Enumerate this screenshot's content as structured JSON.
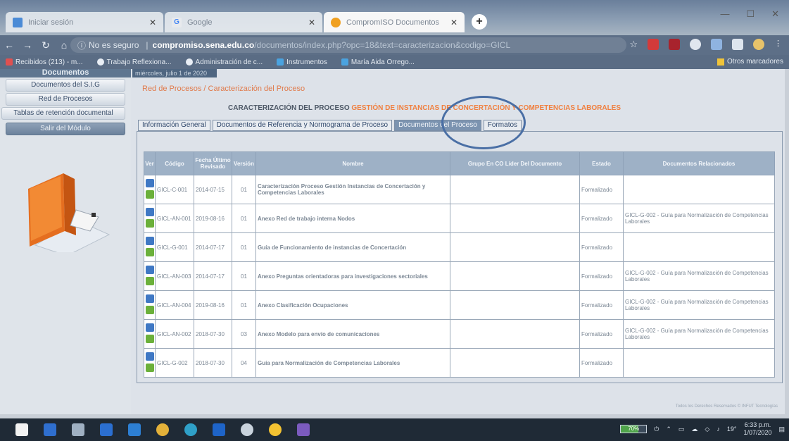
{
  "browser": {
    "tabs": [
      {
        "title": "Iniciar sesión",
        "fav_color": "#4b8bd6"
      },
      {
        "title": "Google",
        "fav_color": "#e8eaed"
      },
      {
        "title": "CompromISO Documentos",
        "fav_color": "#f0a020"
      }
    ],
    "address": {
      "secure_label": "No es seguro",
      "host": "compromiso.sena.edu.co",
      "path": "/documentos/index.php?opc=18&text=caracterizacion&codigo=GICL"
    },
    "bookmarks": [
      "Recibidos (213) - m...",
      "Trabajo Reflexiona...",
      "Administración de c...",
      "Instrumentos",
      "María Aida Orrego..."
    ],
    "bookmarks_other": "Otros marcadores"
  },
  "sidebar": {
    "heading": "Documentos",
    "items": [
      "Documentos del S.I.G",
      "Red de Procesos",
      "Tablas de retención documental",
      "Salir del Módulo"
    ]
  },
  "content": {
    "date_strip": "miércoles, julio 1 de 2020",
    "breadcrumb": "Red de Procesos / Caracterización del Proceso",
    "title_prefix": "CARACTERIZACIÓN DEL PROCESO",
    "title_name": "GESTIÓN DE INSTANCIAS DE CONCERTACIÓN Y COMPETENCIAS LABORALES",
    "tabs": [
      "Información General",
      "Documentos de Referencia y Normograma de Proceso",
      "Documentos del Proceso",
      "Formatos"
    ],
    "selected_tab": 2,
    "table": {
      "headers": [
        "Ver",
        "Código",
        "Fecha Último Revisado",
        "Versión",
        "Nombre",
        "Grupo En CO Líder Del Documento",
        "Estado",
        "Documentos Relacionados"
      ],
      "rows": [
        {
          "codigo": "GICL-C-001",
          "fecha": "2014-07-15",
          "version": "01",
          "nombre": "Caracterización Proceso Gestión Instancias de Concertación y Competencias Laborales",
          "grupo": "",
          "estado": "Formalizado",
          "relacionados": ""
        },
        {
          "codigo": "GICL-AN-001",
          "fecha": "2019-08-16",
          "version": "01",
          "nombre": "Anexo Red de trabajo interna Nodos",
          "grupo": "",
          "estado": "Formalizado",
          "relacionados": "GICL-G-002 - Guía para Normalización de Competencias Laborales"
        },
        {
          "codigo": "GICL-G-001",
          "fecha": "2014-07-17",
          "version": "01",
          "nombre": "Guía de Funcionamiento de instancias de Concertación",
          "grupo": "",
          "estado": "Formalizado",
          "relacionados": ""
        },
        {
          "codigo": "GICL-AN-003",
          "fecha": "2014-07-17",
          "version": "01",
          "nombre": "Anexo Preguntas orientadoras para investigaciones sectoriales",
          "grupo": "",
          "estado": "Formalizado",
          "relacionados": "GICL-G-002 - Guía para Normalización de Competencias Laborales"
        },
        {
          "codigo": "GICL-AN-004",
          "fecha": "2019-08-16",
          "version": "01",
          "nombre": "Anexo Clasificación Ocupaciones",
          "grupo": "",
          "estado": "Formalizado",
          "relacionados": "GICL-G-002 - Guía para Normalización de Competencias Laborales"
        },
        {
          "codigo": "GICL-AN-002",
          "fecha": "2018-07-30",
          "version": "03",
          "nombre": "Anexo Modelo para envío de comunicaciones",
          "grupo": "",
          "estado": "Formalizado",
          "relacionados": "GICL-G-002 - Guía para Normalización de Competencias Laborales"
        },
        {
          "codigo": "GICL-G-002",
          "fecha": "2018-07-30",
          "version": "04",
          "nombre": "Guía para Normalización de Competencias Laborales",
          "grupo": "",
          "estado": "Formalizado",
          "relacionados": ""
        }
      ]
    },
    "footer": "Todos los Derechos Reservados © INFUT Tecnologías"
  },
  "taskbar": {
    "icons": [
      "store-icon",
      "mail-icon",
      "explorer-icon",
      "word-icon",
      "files-icon",
      "chrome-icon",
      "edge-icon",
      "outlook-icon",
      "cloud-icon",
      "sticky-icon",
      "teams-icon"
    ],
    "battery_level": 0.7,
    "battery_label": "70%",
    "temp": "19°",
    "time": "6:33 p.m.",
    "date": "1/07/2020"
  },
  "colors": {
    "accent_orange": "#f08040",
    "header_blue": "#9eb1c6",
    "selected_tab": "#7b93b0",
    "annotation_circle": "#4a6fa5"
  }
}
